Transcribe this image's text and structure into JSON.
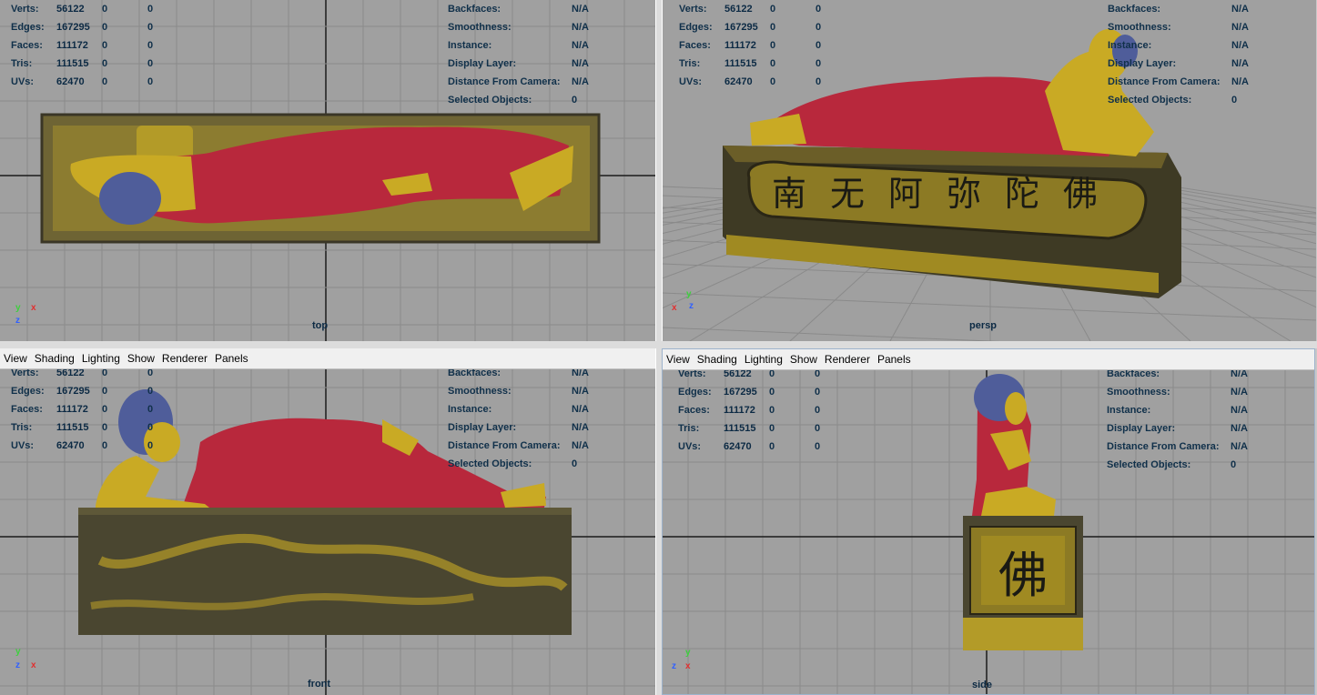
{
  "stats": {
    "labels": [
      "Verts:",
      "Edges:",
      "Faces:",
      "Tris:",
      "UVs:"
    ],
    "values": [
      [
        "56122",
        "0",
        "0"
      ],
      [
        "167295",
        "0",
        "0"
      ],
      [
        "111172",
        "0",
        "0"
      ],
      [
        "111515",
        "0",
        "0"
      ],
      [
        "62470",
        "0",
        "0"
      ]
    ]
  },
  "info": {
    "labels": [
      "Backfaces:",
      "Smoothness:",
      "Instance:",
      "Display Layer:",
      "Distance From Camera:",
      "Selected Objects:"
    ],
    "values": [
      "N/A",
      "N/A",
      "N/A",
      "N/A",
      "N/A",
      "0"
    ]
  },
  "menu": [
    "View",
    "Shading",
    "Lighting",
    "Show",
    "Renderer",
    "Panels"
  ],
  "viewports": {
    "top": "top",
    "persp": "persp",
    "front": "front",
    "side": "side"
  },
  "inscription": {
    "base_front": "南无阿弥陀佛",
    "base_side": "佛"
  },
  "axes": {
    "x": "x",
    "y": "y",
    "z": "z"
  },
  "colors": {
    "viewport_bg": "#a0a0a0",
    "grid": "#8a8a8a",
    "grid_axis": "#1a1a1a",
    "robe": "#b8283c",
    "gold": "#d2b31e",
    "hair": "#4f5d9a",
    "base_dark": "#3a3626"
  }
}
